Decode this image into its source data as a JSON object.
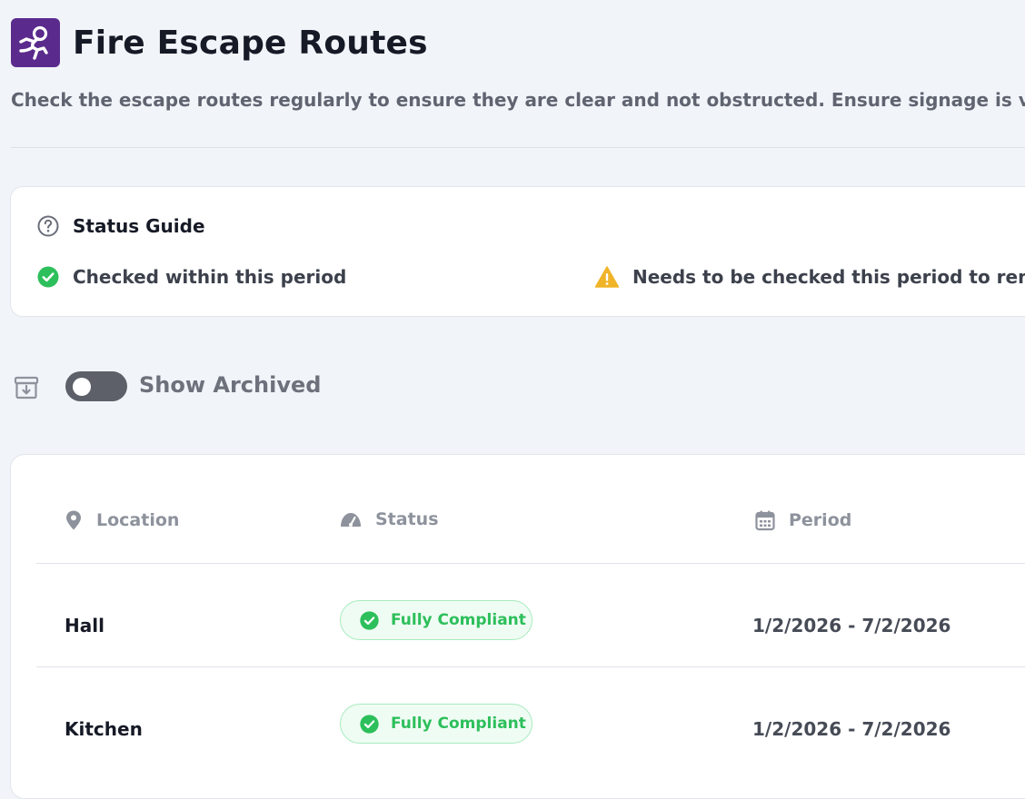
{
  "header": {
    "title": "Fire Escape Routes",
    "description": "Check the escape routes regularly to ensure they are clear and not obstructed. Ensure signage is visible and"
  },
  "status_guide": {
    "title": "Status Guide",
    "checked_label": "Checked within this period",
    "needs_check_label": "Needs to be checked this period to remain"
  },
  "filters": {
    "show_archived_label": "Show Archived",
    "show_archived_on": false
  },
  "table": {
    "columns": {
      "location": "Location",
      "status": "Status",
      "period": "Period"
    },
    "rows": [
      {
        "location": "Hall",
        "status": "Fully Compliant",
        "period": "1/2/2026 - 7/2/2026"
      },
      {
        "location": "Kitchen",
        "status": "Fully Compliant",
        "period": "1/2/2026 - 7/2/2026"
      }
    ]
  },
  "colors": {
    "brand": "#5a2b8c",
    "success": "#2dbf5b",
    "warning": "#f0b429"
  },
  "icons": {
    "logo": "running-person-icon",
    "guide": "question-circle-icon",
    "checked": "check-circle-icon",
    "warning": "warning-triangle-icon",
    "archive": "archive-box-icon",
    "location": "map-pin-icon",
    "status": "gauge-icon",
    "period": "calendar-icon"
  }
}
